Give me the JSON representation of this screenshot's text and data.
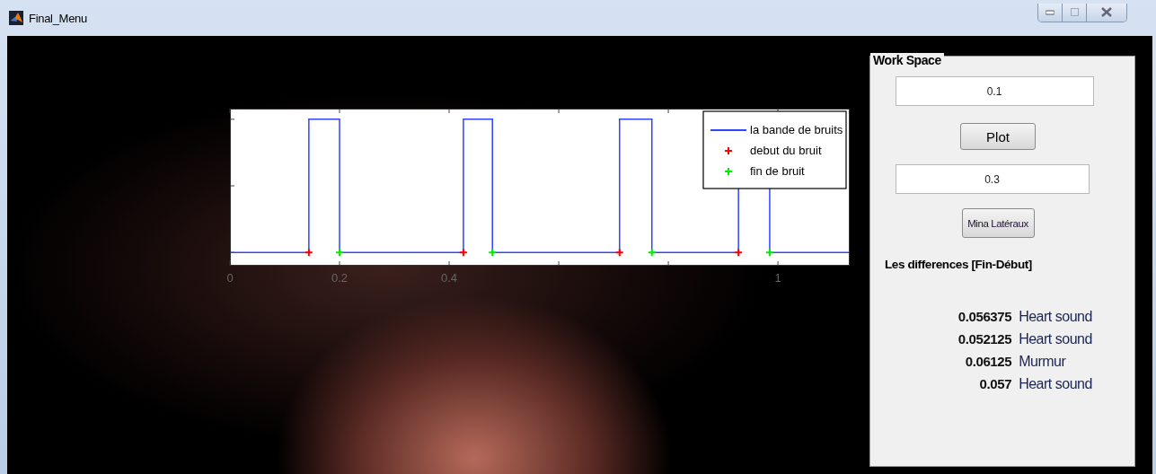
{
  "window": {
    "title": "Final_Menu"
  },
  "chart": {
    "legend": [
      {
        "label": "la bande de bruits",
        "color": "#3344ff",
        "kind": "line"
      },
      {
        "label": "debut du bruit",
        "color": "#ff0000",
        "kind": "marker"
      },
      {
        "label": "fin de bruit",
        "color": "#00ee00",
        "kind": "marker"
      }
    ],
    "x_tick_labels": [
      "0",
      "0.2",
      "0.4",
      "1"
    ]
  },
  "workspace": {
    "title": "Work Space",
    "field_1": {
      "value": "0.1"
    },
    "plot_button": "Plot",
    "field_2": {
      "value": "0.3"
    },
    "mina_button": "Mina Latéraux",
    "differences_label": "Les differences [Fin-Début]",
    "results": [
      {
        "value": "0.056375",
        "label": "Heart sound"
      },
      {
        "value": "0.052125",
        "label": "Heart sound"
      },
      {
        "value": "0.06125",
        "label": "Murmur"
      },
      {
        "value": "0.057",
        "label": "Heart sound"
      }
    ]
  }
}
